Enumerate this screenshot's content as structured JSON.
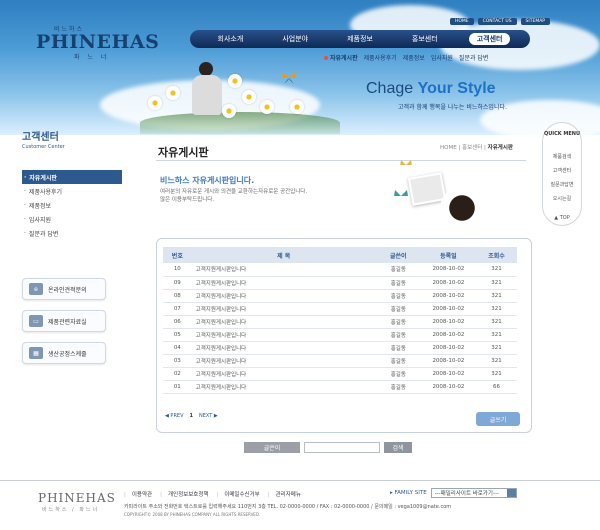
{
  "header": {
    "logo_ko": "비느하스",
    "logo": "PHINEHAS",
    "logo_sub": "파 느 너",
    "toplinks": [
      "HOME",
      "CONTACT US",
      "SITEMAP"
    ],
    "gnb": [
      "회사소개",
      "사업분야",
      "제품정보",
      "홍보센터",
      "고객센터"
    ],
    "gnb_active": "고객센터",
    "subnav": [
      "자유게시판",
      "제품사용후기",
      "제품정보",
      "입사지원",
      "질문과 답변"
    ],
    "slogan_plain": "Chage ",
    "slogan_bold": "Your Style",
    "slogan_sub": "고객과 함께 행복을 나누는 비느하스입니다."
  },
  "sidebar": {
    "title": "고객센터",
    "title_en": "Customer Center",
    "menu": [
      "자유게시판",
      "제품사용후기",
      "제품정보",
      "입사지원",
      "질문과 답변"
    ],
    "active": "자유게시판",
    "buttons": [
      "온라인견적문의",
      "제품관련자료실",
      "생산공정스케줄"
    ]
  },
  "content": {
    "page_title": "자유게시판",
    "crumb": [
      "HOME",
      "홍보센터",
      "자유게시판"
    ],
    "intro_head": "비느하스 자유게시판입니다.",
    "intro_text": [
      "여러분의 자유로운 게시와 의견을 교환하는자유로운 공간입니다.",
      "많은 이용부탁드립니다."
    ]
  },
  "board": {
    "columns": [
      "번호",
      "제 목",
      "글쓴이",
      "등록일",
      "조회수"
    ],
    "rows": [
      {
        "no": "10",
        "subject": "고객지원게시판입니다",
        "writer": "홍길동",
        "date": "2008-10-02",
        "views": "321"
      },
      {
        "no": "09",
        "subject": "고객지원게시판입니다",
        "writer": "홍길동",
        "date": "2008-10-02",
        "views": "321"
      },
      {
        "no": "08",
        "subject": "고객지원게시판입니다",
        "writer": "홍길동",
        "date": "2008-10-02",
        "views": "321"
      },
      {
        "no": "07",
        "subject": "고객지원게시판입니다",
        "writer": "홍길동",
        "date": "2008-10-02",
        "views": "321"
      },
      {
        "no": "06",
        "subject": "고객지원게시판입니다",
        "writer": "홍길동",
        "date": "2008-10-02",
        "views": "321"
      },
      {
        "no": "05",
        "subject": "고객지원게시판입니다",
        "writer": "홍길동",
        "date": "2008-10-02",
        "views": "321"
      },
      {
        "no": "04",
        "subject": "고객지원게시판입니다",
        "writer": "홍길동",
        "date": "2008-10-02",
        "views": "321"
      },
      {
        "no": "03",
        "subject": "고객지원게시판입니다",
        "writer": "홍길동",
        "date": "2008-10-02",
        "views": "321"
      },
      {
        "no": "02",
        "subject": "고객지원게시판입니다",
        "writer": "홍길동",
        "date": "2008-10-02",
        "views": "321"
      },
      {
        "no": "01",
        "subject": "고객지원게시판입니다",
        "writer": "홍길동",
        "date": "2008-10-02",
        "views": "66"
      }
    ],
    "pager_prev": "◀ PREV",
    "pager_current": "1",
    "pager_next": "NEXT ▶",
    "write_label": "글쓰기"
  },
  "search": {
    "select_value": "글쓴이",
    "button": "검색"
  },
  "quick": {
    "title": "QUICK MENU",
    "items": [
      "제품검색",
      "고객센터",
      "질문과답변",
      "오시는길"
    ],
    "top": "TOP"
  },
  "footer": {
    "logo": "PHINEHAS",
    "logo_sub": "비느하스 / 파느너",
    "links": [
      "이용약관",
      "개인정보보호정책",
      "이메일수신거부",
      "관리자메뉴"
    ],
    "family_label": "▸ FAMILY SITE",
    "family_value": "---패밀리사이트 바로가기---",
    "info": "카피라이트 주소와 전화번호 텍스트로를 입력해주세요 110번지 3층     TEL. 02-0000-0000 / FAX : 02-0000-0000 / 문의메일 : vega1009@nate.com",
    "copyright": "COPYRIGHT© 2008 BY PHINEHAS COMPANY ALL RIGHTS RESERVED."
  },
  "colors": {
    "brand": "#2d5a8e",
    "accent": "#3f7ac0",
    "nav_dark": "#0f2a55"
  }
}
